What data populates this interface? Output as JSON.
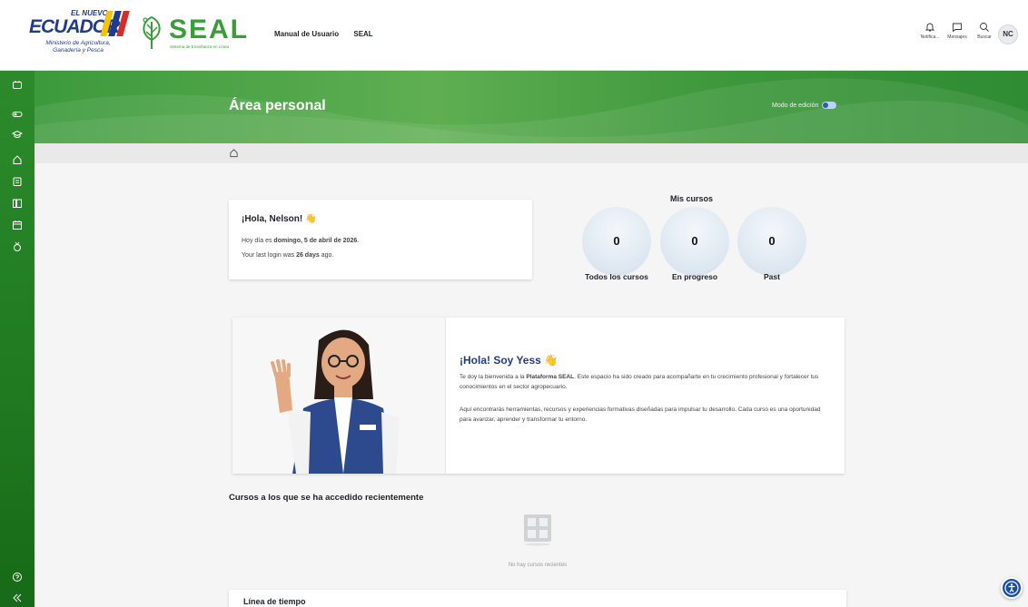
{
  "navbar": {
    "ecuador_top": "EL NUEVO",
    "ecuador_main": "ECUADOR",
    "ministry_line1": "Ministerio de Agricultura,",
    "ministry_line2": "Ganadería y Pesca",
    "seal_name": "SEAL",
    "seal_subtitle": "Sistema de Enseñanza en Línea",
    "links": [
      "Manual de Usuario",
      "SEAL"
    ],
    "tools": [
      {
        "label": "Notifica...",
        "icon": "bell-icon"
      },
      {
        "label": "Mensajes",
        "icon": "message-icon"
      },
      {
        "label": "Buscar",
        "icon": "search-icon"
      }
    ],
    "user_initials": "NC"
  },
  "drawer": {
    "icons": [
      "dashboard-icon",
      "toggle-icon",
      "graduation-icon",
      "home-icon",
      "calendar-list-icon",
      "library-icon",
      "calendar-icon",
      "badge-icon",
      "help-icon",
      "collapse-icon"
    ]
  },
  "header": {
    "title": "Área personal",
    "edit_mode_label": "Modo de edición"
  },
  "greeting": {
    "title": "¡Hola, Nelson! 👋",
    "date_prefix": "Hoy día es ",
    "date_value": "domingo, 5 de abril de 2026",
    "date_suffix": ".",
    "login_prefix": "Your last login was ",
    "login_value": "26 days",
    "login_suffix": " ago."
  },
  "mis_cursos": {
    "title": "Mis cursos",
    "stats": [
      {
        "value": "0",
        "label": "Todos los cursos"
      },
      {
        "value": "0",
        "label": "En progreso"
      },
      {
        "value": "0",
        "label": "Past"
      }
    ]
  },
  "yess": {
    "title": "¡Hola! Soy Yess 👋",
    "p1_prefix": "Te doy la bienvenida a la ",
    "p1_bold": "Plataforma SEAL",
    "p1_suffix": ". Este espacio ha sido creado para acompañarte en tu crecimiento profesional y fortalecer tus conocimientos en el sector agropecuario.",
    "p2": "Aquí encontrarás herramientas, recursos y experiencias formativas diseñadas para impulsar tu desarrollo. Cada curso es una oportunidad para avanzar, aprender y transformar tu entorno."
  },
  "recent": {
    "title": "Cursos a los que se ha accedido recientemente",
    "empty_text": "No hay cursos recientes"
  },
  "timeline": {
    "title": "Línea de tiempo"
  },
  "colors": {
    "brand_green": "#3a9d3a",
    "brand_blue": "#1f3c8a"
  }
}
